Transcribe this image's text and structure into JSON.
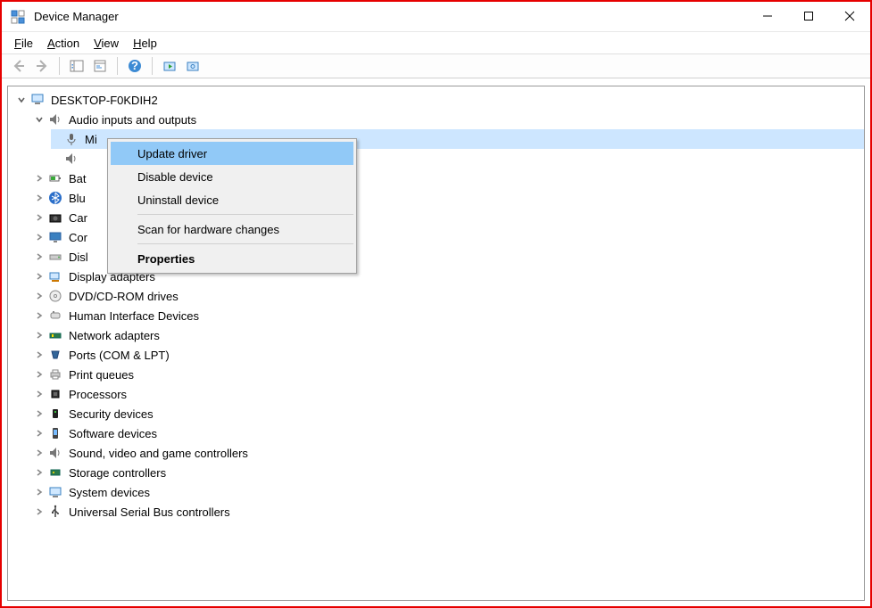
{
  "window": {
    "title": "Device Manager"
  },
  "menu": {
    "file": "File",
    "action": "Action",
    "view": "View",
    "help": "Help"
  },
  "root": "DESKTOP-F0KDIH2",
  "expandedCategory": "Audio inputs and outputs",
  "selectedDeviceTruncated": "Mi",
  "categories": [
    {
      "truncated": "Bat",
      "icon": "battery"
    },
    {
      "truncated": "Blu",
      "icon": "bluetooth"
    },
    {
      "truncated": "Car",
      "icon": "camera"
    },
    {
      "truncated": "Cor",
      "icon": "monitor"
    },
    {
      "truncated": "Disl",
      "icon": "disk"
    },
    {
      "label": "Display adapters",
      "icon": "display"
    },
    {
      "label": "DVD/CD-ROM drives",
      "icon": "cd"
    },
    {
      "label": "Human Interface Devices",
      "icon": "hid"
    },
    {
      "label": "Network adapters",
      "icon": "network"
    },
    {
      "label": "Ports (COM & LPT)",
      "icon": "port"
    },
    {
      "label": "Print queues",
      "icon": "printer"
    },
    {
      "label": "Processors",
      "icon": "cpu"
    },
    {
      "label": "Security devices",
      "icon": "security"
    },
    {
      "label": "Software devices",
      "icon": "software"
    },
    {
      "label": "Sound, video and game controllers",
      "icon": "sound"
    },
    {
      "label": "Storage controllers",
      "icon": "storage"
    },
    {
      "label": "System devices",
      "icon": "system"
    },
    {
      "label": "Universal Serial Bus controllers",
      "icon": "usb"
    }
  ],
  "contextMenu": {
    "updateDriver": "Update driver",
    "disableDevice": "Disable device",
    "uninstallDevice": "Uninstall device",
    "scanHardware": "Scan for hardware changes",
    "properties": "Properties"
  }
}
